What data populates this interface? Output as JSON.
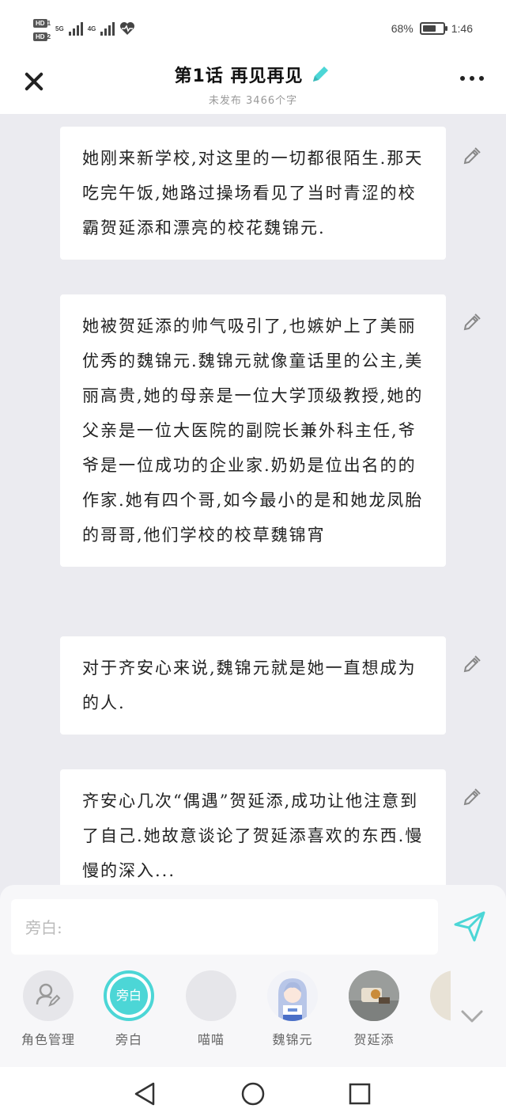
{
  "status_bar": {
    "sim1": "HD",
    "sim1_index": "1",
    "sim2": "HD",
    "sim2_index": "2",
    "net1": "5G",
    "net2": "4G",
    "battery_percent": "68%",
    "battery_level": 0.68,
    "time": "1:46"
  },
  "header": {
    "title": "第1话 再见再见",
    "subtitle": "未发布 3466个字"
  },
  "cards": [
    {
      "text": "她刚来新学校,对这里的一切都很陌生.那天吃完午饭,她路过操场看见了当时青涩的校霸贺延添和漂亮的校花魏锦元."
    },
    {
      "text": "她被贺延添的帅气吸引了,也嫉妒上了美丽优秀的魏锦元.魏锦元就像童话里的公主,美丽高贵,她的母亲是一位大学顶级教授,她的父亲是一位大医院的副院长兼外科主任,爷爷是一位成功的企业家.奶奶是位出名的的作家.她有四个哥,如今最小的是和她龙凤胎的哥哥,他们学校的校草魏锦宵"
    },
    {
      "text": "对于齐安心来说,魏锦元就是她一直想成为的人."
    },
    {
      "text": "齐安心几次“偶遇”贺延添,成功让他注意到了自己.她故意谈论了贺延添喜欢的东西.慢慢的深入..."
    }
  ],
  "input": {
    "placeholder": "旁白:"
  },
  "roles": [
    {
      "label": "角色管理",
      "icon": "role-manage-icon"
    },
    {
      "label": "旁白",
      "badge": "旁白"
    },
    {
      "label": "喵喵"
    },
    {
      "label": "魏锦元"
    },
    {
      "label": "贺延添"
    }
  ],
  "colors": {
    "accent": "#4cd6d6",
    "background": "#ebebf0",
    "card": "#ffffff"
  }
}
